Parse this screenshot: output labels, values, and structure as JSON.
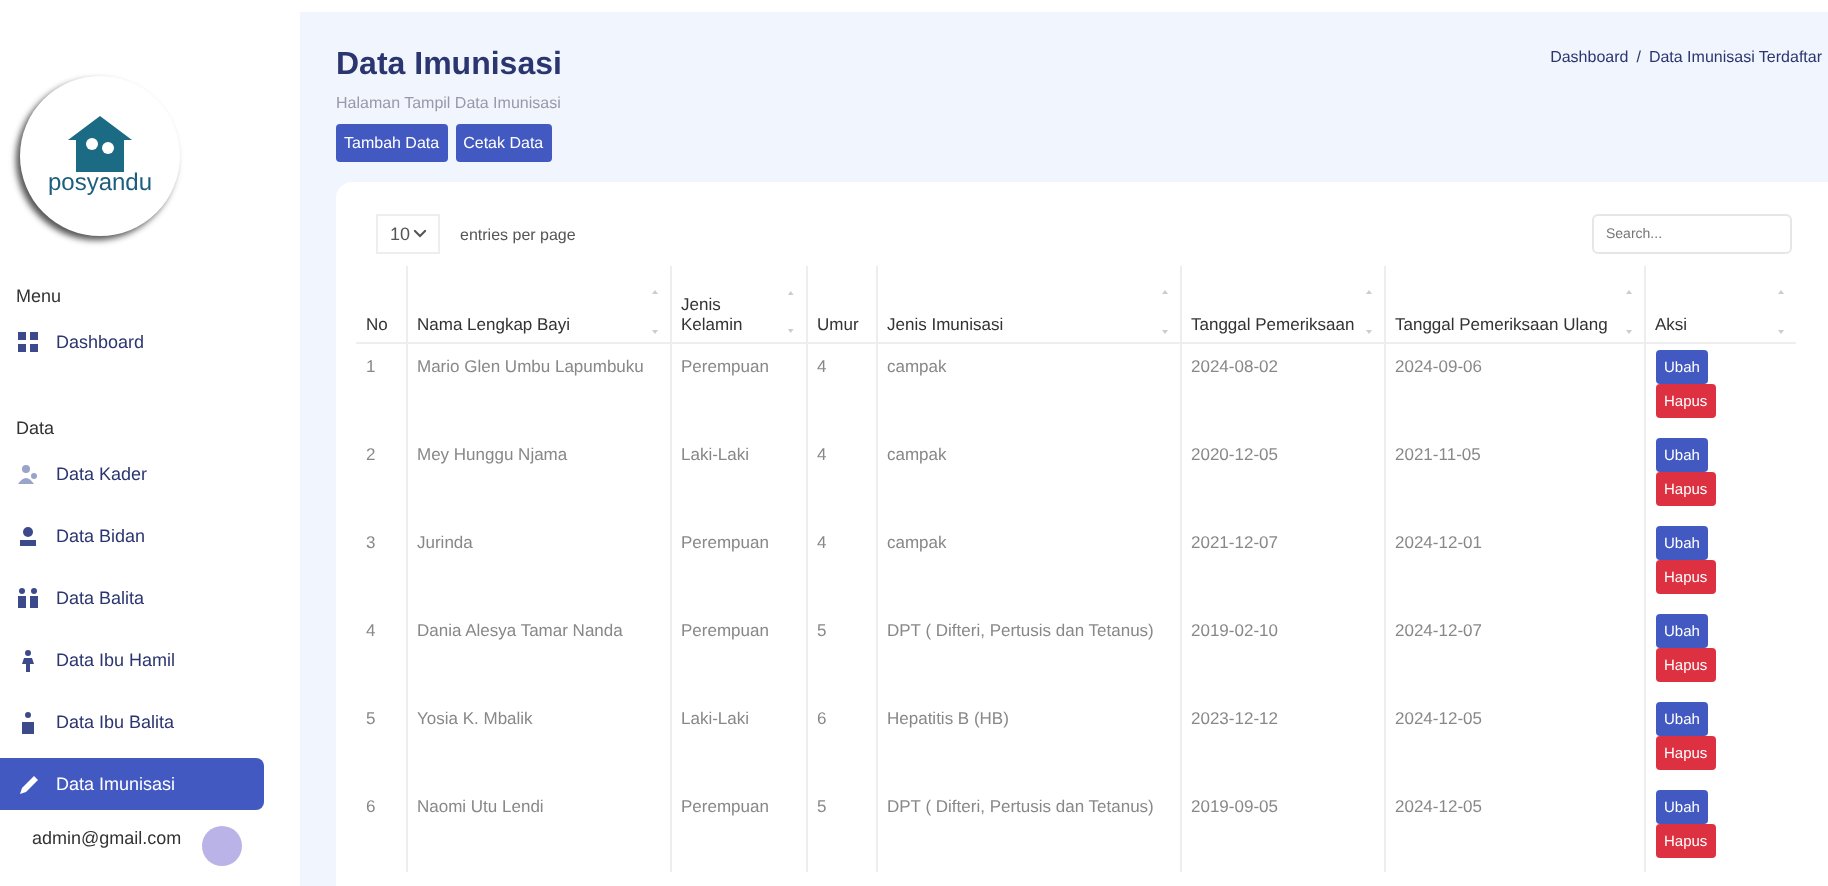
{
  "sidebar": {
    "logo_text": "posyandu",
    "sections": [
      {
        "title": "Menu",
        "items": [
          {
            "label": "Dashboard",
            "selected": false
          }
        ]
      },
      {
        "title": "Data",
        "items": [
          {
            "label": "Data Kader",
            "selected": false
          },
          {
            "label": "Data Bidan",
            "selected": false
          },
          {
            "label": "Data Balita",
            "selected": false
          },
          {
            "label": "Data Ibu Hamil",
            "selected": false
          },
          {
            "label": "Data Ibu Balita",
            "selected": false
          },
          {
            "label": "Data Imunisasi",
            "selected": true
          }
        ]
      }
    ],
    "user": "admin@gmail.com"
  },
  "header": {
    "title": "Data Imunisasi",
    "subtitle": "Halaman Tampil Data Imunisasi",
    "buttons": [
      "Tambah Data",
      "Cetak Data"
    ],
    "breadcrumb": [
      "Dashboard",
      "/",
      "Data Imunisasi Terdaftar"
    ]
  },
  "table": {
    "page_size": "10",
    "page_size_label": "entries per page",
    "search_placeholder": "Search...",
    "columns": [
      "No",
      "Nama Lengkap Bayi",
      "Jenis Kelamin",
      "Umur",
      "Jenis Imunisasi",
      "Tanggal Pemeriksaan",
      "Tanggal Pemeriksaan Ulang",
      "Aksi"
    ],
    "rows": [
      {
        "cells": [
          "1",
          "Mario Glen Umbu Lapumbuku",
          "Perempuan",
          "4",
          "campak",
          "2024-08-02",
          "2024-09-06"
        ],
        "actions": [
          "Ubah",
          "Hapus"
        ]
      },
      {
        "cells": [
          "2",
          "Mey Hunggu Njama",
          "Laki-Laki",
          "4",
          "campak",
          "2020-12-05",
          "2021-11-05"
        ],
        "actions": [
          "Ubah",
          "Hapus"
        ]
      },
      {
        "cells": [
          "3",
          "Jurinda",
          "Perempuan",
          "4",
          "campak",
          "2021-12-07",
          "2024-12-01"
        ],
        "actions": [
          "Ubah",
          "Hapus"
        ]
      },
      {
        "cells": [
          "4",
          "Dania Alesya Tamar Nanda",
          "Perempuan",
          "5",
          "DPT ( Difteri, Pertusis dan Tetanus)",
          "2019-02-10",
          "2024-12-07"
        ],
        "actions": [
          "Ubah",
          "Hapus"
        ]
      },
      {
        "cells": [
          "5",
          "Yosia K. Mbalik",
          "Laki-Laki",
          "6",
          "Hepatitis B (HB)",
          "2023-12-12",
          "2024-12-05"
        ],
        "actions": [
          "Ubah",
          "Hapus"
        ]
      },
      {
        "cells": [
          "6",
          "Naomi Utu Lendi",
          "Perempuan",
          "5",
          "DPT ( Difteri, Pertusis dan Tetanus)",
          "2019-09-05",
          "2024-12-05"
        ],
        "actions": [
          "Ubah",
          "Hapus"
        ]
      }
    ]
  }
}
